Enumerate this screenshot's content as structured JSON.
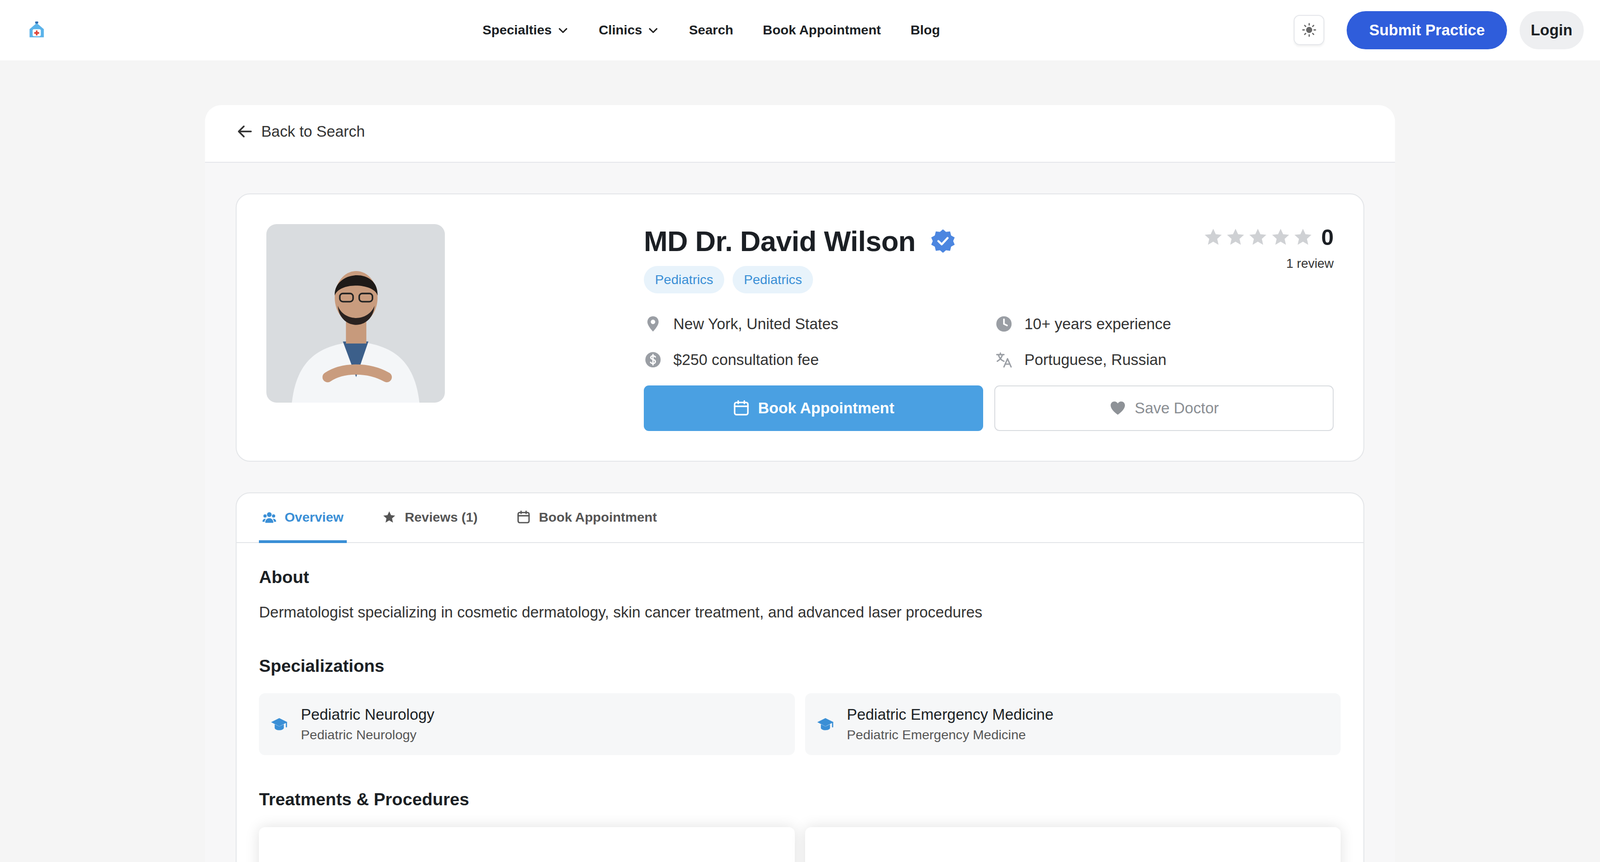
{
  "nav": {
    "links": [
      {
        "label": "Specialties",
        "dropdown": true
      },
      {
        "label": "Clinics",
        "dropdown": true
      },
      {
        "label": "Search",
        "dropdown": false
      },
      {
        "label": "Book Appointment",
        "dropdown": false
      },
      {
        "label": "Blog",
        "dropdown": false
      }
    ],
    "submit": "Submit Practice",
    "login": "Login"
  },
  "back": "Back to Search",
  "doctor": {
    "name": "MD Dr. David Wilson",
    "verified": true,
    "tags": [
      "Pediatrics",
      "Pediatrics"
    ],
    "rating": {
      "stars": 0,
      "value": "0",
      "reviews": "1 review"
    },
    "details": [
      {
        "kind": "location",
        "text": "New York, United States"
      },
      {
        "kind": "experience",
        "text": "10+ years experience"
      },
      {
        "kind": "fee",
        "text": "$250 consultation fee"
      },
      {
        "kind": "languages",
        "text": "Portuguese, Russian"
      }
    ],
    "book": "Book Appointment",
    "save": "Save Doctor"
  },
  "tabs": [
    {
      "label": "Overview",
      "kind": "overview",
      "selected": true
    },
    {
      "label": "Reviews (1)",
      "kind": "reviews",
      "selected": false
    },
    {
      "label": "Book Appointment",
      "kind": "book",
      "selected": false
    }
  ],
  "about": {
    "title": "About",
    "text": "Dermatologist specializing in cosmetic dermatology, skin cancer treatment, and advanced laser procedures"
  },
  "specializations": {
    "title": "Specializations",
    "items": [
      {
        "name": "Pediatric Neurology",
        "detail": "Pediatric Neurology"
      },
      {
        "name": "Pediatric Emergency Medicine",
        "detail": "Pediatric Emergency Medicine"
      }
    ]
  },
  "treatments": {
    "title": "Treatments & Procedures"
  }
}
